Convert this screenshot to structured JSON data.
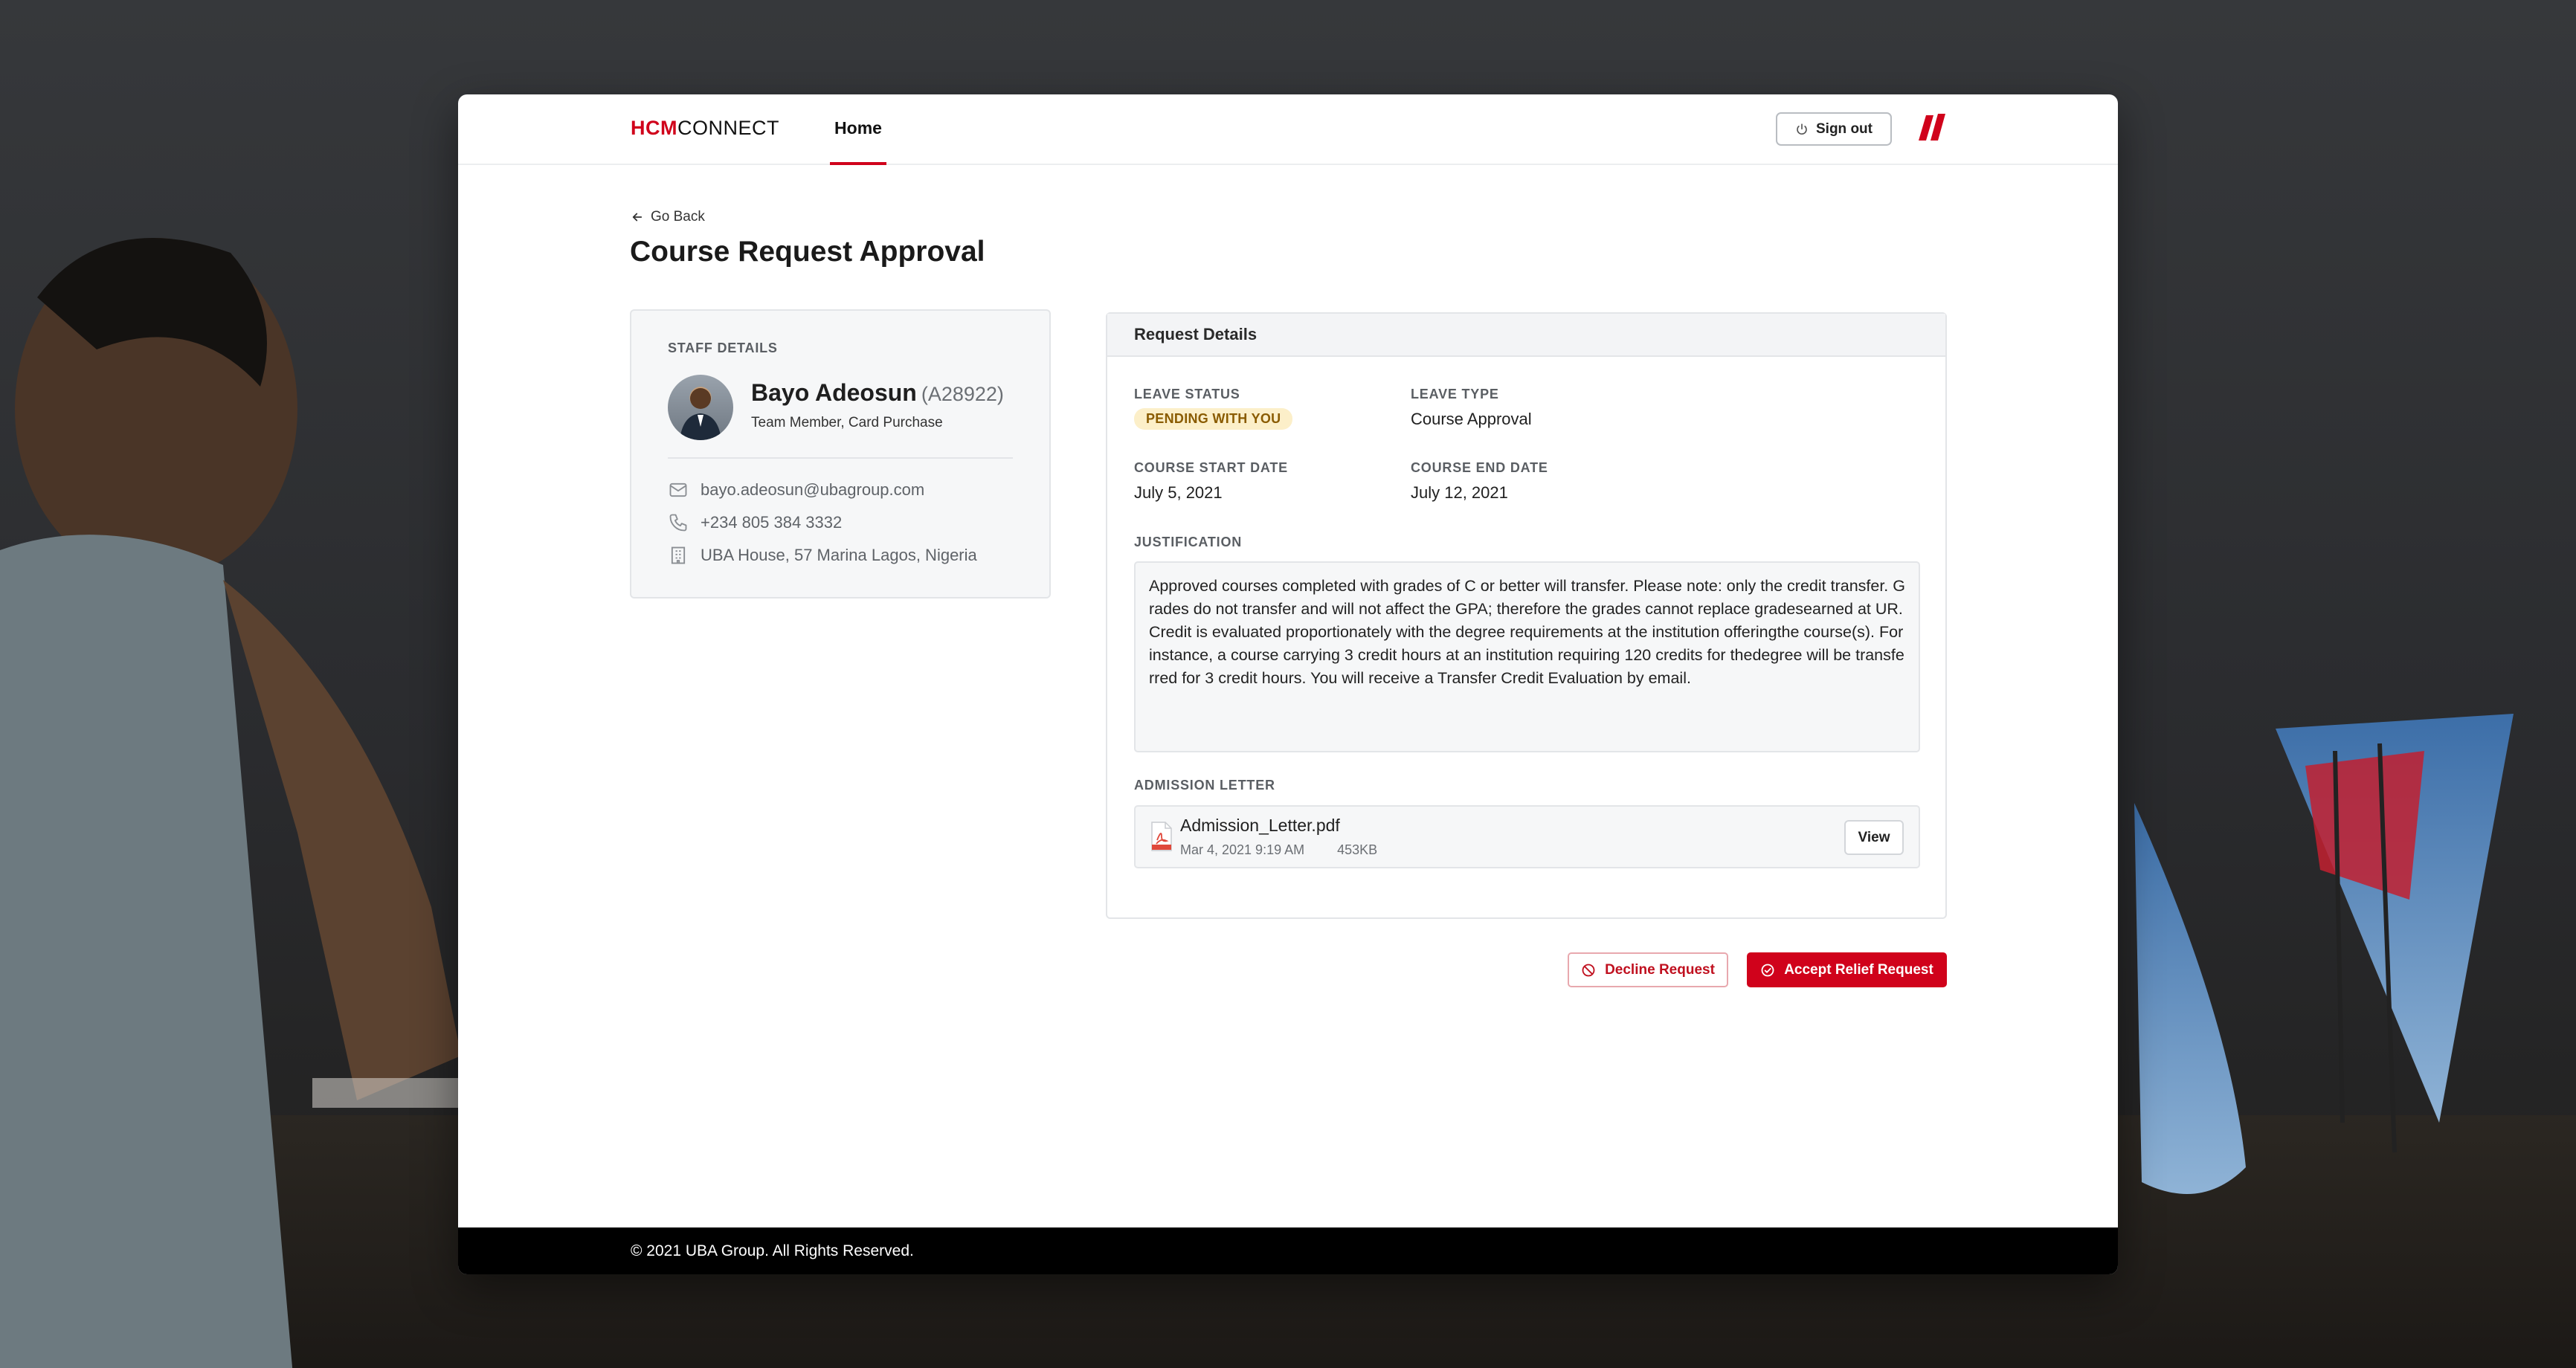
{
  "app": {
    "logo_hcm": "HCM",
    "logo_connect": "CONNECT",
    "nav_home": "Home",
    "sign_out": "Sign out",
    "accent_color": "#d0021b"
  },
  "page": {
    "go_back": "Go Back",
    "title": "Course Request Approval"
  },
  "staff": {
    "section_label": "STAFF DETAILS",
    "name": "Bayo Adeosun",
    "id": "(A28922)",
    "role": "Team Member, Card Purchase",
    "email": "bayo.adeosun@ubagroup.com",
    "phone": "+234 805 384 3332",
    "address": "UBA House, 57 Marina Lagos, Nigeria"
  },
  "request": {
    "header": "Request Details",
    "leave_status_label": "LEAVE STATUS",
    "leave_status_value": "PENDING WITH YOU",
    "leave_type_label": "LEAVE TYPE",
    "leave_type_value": "Course Approval",
    "start_label": "COURSE START DATE",
    "start_value": "July 5, 2021",
    "end_label": "COURSE END DATE",
    "end_value": "July 12, 2021",
    "justification_label": "JUSTIFICATION",
    "justification_text": "Approved courses completed with grades of C or better will transfer. Please note: only the credit transfer. Grades do not transfer and will not affect the GPA; therefore the grades cannot replace gradesearned at UR. Credit is evaluated proportionately with the degree requirements at the institution offeringthe course(s). For instance, a course carrying 3 credit hours at an institution requiring 120 credits for thedegree will be transferred for 3 credit hours. You will receive a Transfer Credit Evaluation by email.",
    "admission_label": "ADMISSION LETTER",
    "file_name": "Admission_Letter.pdf",
    "file_date": "Mar 4, 2021 9:19 AM",
    "file_size": "453KB",
    "view_button": "View"
  },
  "actions": {
    "decline": "Decline Request",
    "accept": "Accept Relief Request"
  },
  "footer": {
    "copyright": "© 2021 UBA Group. All Rights Reserved."
  },
  "icons": {
    "back": "arrow-left-icon",
    "signout": "power-icon",
    "email": "mail-icon",
    "phone": "phone-icon",
    "address": "building-icon",
    "file": "pdf-file-icon",
    "decline": "block-icon",
    "accept": "check-circle-icon"
  }
}
